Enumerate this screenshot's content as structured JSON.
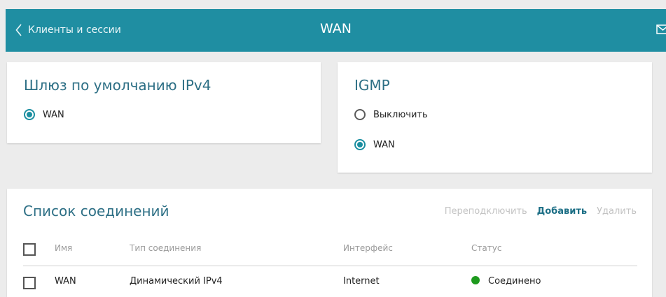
{
  "header": {
    "back_label": "Клиенты и сессии",
    "title": "WAN",
    "back_icon": "chevron-left-icon",
    "mail_icon": "envelope-icon"
  },
  "gateway": {
    "title": "Шлюз по умолчанию IPv4",
    "options": [
      {
        "label": "WAN",
        "selected": true
      }
    ]
  },
  "igmp": {
    "title": "IGMP",
    "options": [
      {
        "label": "Выключить",
        "selected": false
      },
      {
        "label": "WAN",
        "selected": true
      }
    ]
  },
  "connections": {
    "title": "Список соединений",
    "actions": {
      "reconnect": "Переподключить",
      "add": "Добавить",
      "delete": "Удалить"
    },
    "columns": {
      "name": "Имя",
      "type": "Тип соединения",
      "interface": "Интерфейс",
      "status": "Статус"
    },
    "rows": [
      {
        "name": "WAN",
        "type": "Динамический IPv4",
        "interface": "Internet",
        "status": "Соединено",
        "status_color": "#1e9a1e"
      }
    ]
  },
  "colors": {
    "header_bg": "#1f8ea2",
    "accent": "#1a8ea0",
    "title_text": "#2d6f85",
    "link": "#1d6f86",
    "status_ok": "#1e9a1e"
  }
}
